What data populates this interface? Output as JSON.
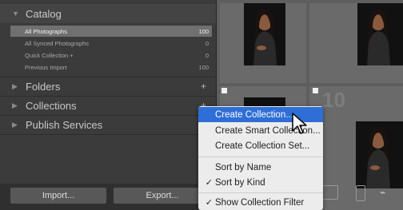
{
  "catalog": {
    "title": "Catalog",
    "rows": [
      {
        "label": "All Photographs",
        "count": "100"
      },
      {
        "label": "All Synced Photographs",
        "count": "0"
      },
      {
        "label": "Quick Collection +",
        "count": "0"
      },
      {
        "label": "Previous Import",
        "count": "100"
      }
    ]
  },
  "panels": {
    "folders": {
      "title": "Folders",
      "plus": "+"
    },
    "collections": {
      "title": "Collections",
      "plus": "+"
    },
    "publish": {
      "title": "Publish Services",
      "plus": "+"
    }
  },
  "bottom": {
    "import_label": "Import...",
    "export_label": "Export..."
  },
  "grid": {
    "cell_number": "10"
  },
  "context_menu": {
    "items": [
      {
        "label": "Create Collection...",
        "check": ""
      },
      {
        "label": "Create Smart Collection...",
        "check": ""
      },
      {
        "label": "Create Collection Set...",
        "check": ""
      },
      {
        "label": "Sort by Name",
        "check": ""
      },
      {
        "label": "Sort by Kind",
        "check": "✓"
      },
      {
        "label": "Show Collection Filter",
        "check": "✓"
      }
    ]
  },
  "colors": {
    "menu_highlight": "#2e6ed6",
    "panel_bg": "#3b3b3b",
    "selected_row": "#707070"
  }
}
